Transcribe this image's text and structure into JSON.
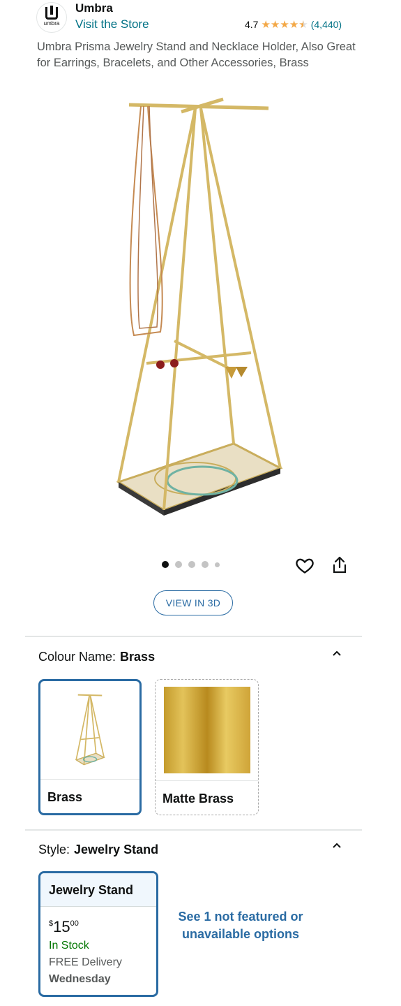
{
  "brand": {
    "logo_text": "umbra",
    "name": "Umbra",
    "store_link": "Visit the Store"
  },
  "rating": {
    "value": "4.7",
    "stars": 4.7,
    "count": "(4,440)"
  },
  "product": {
    "title": "Umbra Prisma Jewelry Stand and Necklace Holder, Also Great for Earrings, Bracelets, and Other Accessories, Brass",
    "image_icon": "jewelry-stand-image",
    "image_count": 5,
    "active_image": 1
  },
  "actions": {
    "favorite_icon": "heart-icon",
    "share_icon": "share-icon",
    "view_3d": "VIEW IN 3D"
  },
  "colour": {
    "label": "Colour Name:",
    "selected": "Brass",
    "options": [
      {
        "label": "Brass",
        "selected": true
      },
      {
        "label": "Matte Brass",
        "selected": false
      }
    ]
  },
  "style": {
    "label": "Style:",
    "selected": "Jewelry Stand",
    "card": {
      "title": "Jewelry Stand",
      "price_symbol": "$",
      "price_whole": "15",
      "price_fraction": "00",
      "stock": "In Stock",
      "delivery": "FREE Delivery",
      "delivery_day": "Wednesday"
    },
    "see_more": "See 1 not featured or unavailable options"
  },
  "colors": {
    "link": "#007185",
    "accent_blue": "#2a6ba3",
    "star": "#f3a847",
    "in_stock": "#007600",
    "brass": "#d4b866"
  }
}
